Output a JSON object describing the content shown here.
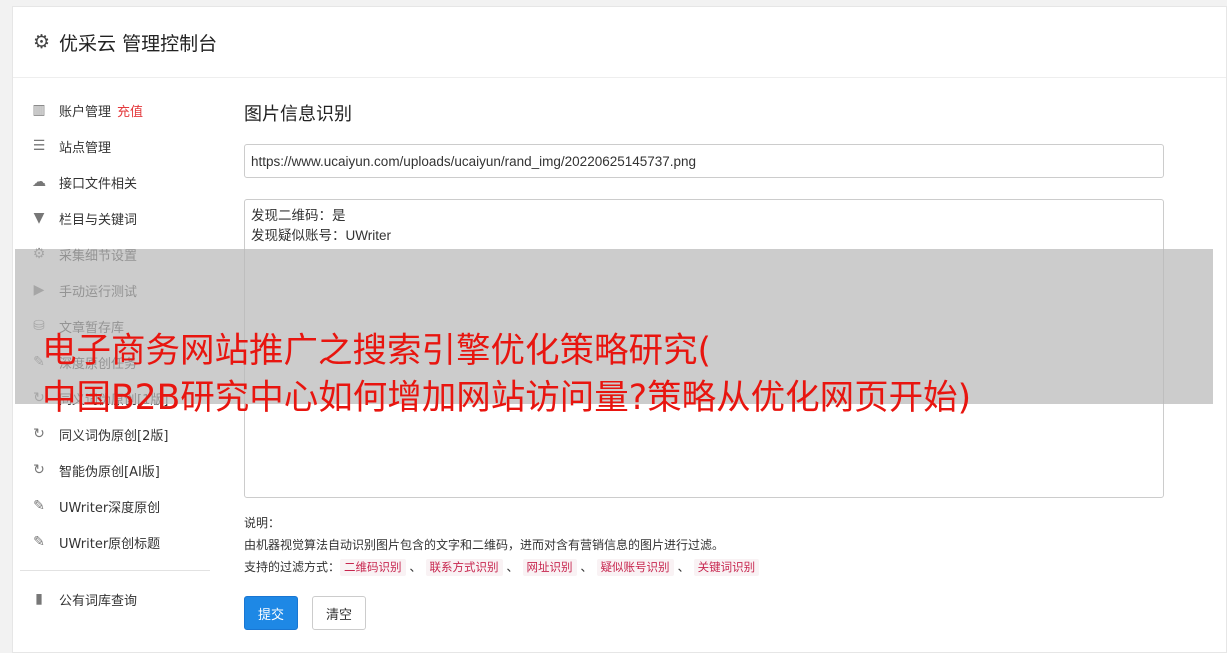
{
  "header": {
    "icon": "gear-icon",
    "title": "优采云 管理控制台"
  },
  "sidebar": {
    "items": [
      {
        "icon": "bar-chart-icon",
        "glyph": "▥",
        "label": "账户管理",
        "badge": "充值"
      },
      {
        "icon": "server-icon",
        "glyph": "☰",
        "label": "站点管理"
      },
      {
        "icon": "cloud-upload-icon",
        "glyph": "☁",
        "label": "接口文件相关"
      },
      {
        "icon": "filter-icon",
        "glyph": "▼",
        "label": "栏目与关键词"
      },
      {
        "icon": "cogs-icon",
        "glyph": "⚙",
        "label": "采集细节设置"
      },
      {
        "icon": "play-circle-icon",
        "glyph": "▶",
        "label": "手动运行测试"
      },
      {
        "icon": "database-icon",
        "glyph": "⛁",
        "label": "文章暂存库"
      },
      {
        "icon": "edit-icon",
        "glyph": "✎",
        "label": "深度原创任务"
      },
      {
        "icon": "refresh-icon",
        "glyph": "↻",
        "label": "同义词伪原创[1版]"
      },
      {
        "icon": "refresh-icon",
        "glyph": "↻",
        "label": "同义词伪原创[2版]"
      },
      {
        "icon": "refresh-icon",
        "glyph": "↻",
        "label": "智能伪原创[AI版]"
      },
      {
        "icon": "edit-icon",
        "glyph": "✎",
        "label": "UWriter深度原创"
      },
      {
        "icon": "edit-icon",
        "glyph": "✎",
        "label": "UWriter原创标题"
      }
    ],
    "extra_items": [
      {
        "icon": "book-icon",
        "glyph": "▮",
        "label": "公有词库查询"
      }
    ]
  },
  "main": {
    "title": "图片信息识别",
    "url_value": "https://www.ucaiyun.com/uploads/ucaiyun/rand_img/20220625145737.png",
    "result_text": "发现二维码：是\n发现疑似账号：UWriter",
    "notes_title": "说明：",
    "notes_desc": "由机器视觉算法自动识别图片包含的文字和二维码，进而对含有营销信息的图片进行过滤。",
    "filters_label": "支持的过滤方式：",
    "filters": [
      "二维码识别",
      "联系方式识别",
      "网址识别",
      "疑似账号识别",
      "关键词识别"
    ],
    "filter_separator": "、",
    "submit_label": "提交",
    "clear_label": "清空"
  },
  "overlay": {
    "line1": "电子商务网站推广之搜索引擎优化策略研究(",
    "line2": "中国B2B研究中心如何增加网站访问量?策略从优化网页开始)"
  }
}
